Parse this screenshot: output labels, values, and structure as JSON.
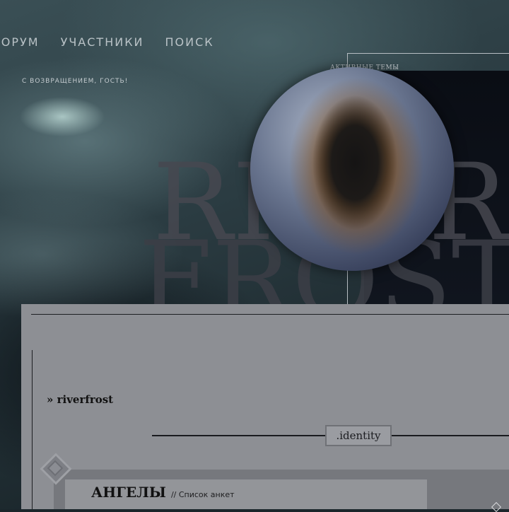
{
  "nav": {
    "items": [
      "ФОРУМ",
      "УЧАСТНИКИ",
      "ПОИСК"
    ]
  },
  "header": {
    "welcome": "С ВОЗВРАЩЕНИЕМ, ГОСТЬ!",
    "active_topics": "АКТИВНЫЕ ТЕМЫ",
    "title_line1": "RIVER",
    "title_line2": "FROST"
  },
  "breadcrumb": {
    "text": "» riverfrost"
  },
  "section": {
    "divider_label": ".identity"
  },
  "card": {
    "title": "АНГЕЛЫ",
    "subtitle": "// Список анкет"
  },
  "colors": {
    "content_bg": "#8d8f94",
    "dark_panel": "#0a0d14",
    "nav_text": "#b9c2c6"
  }
}
